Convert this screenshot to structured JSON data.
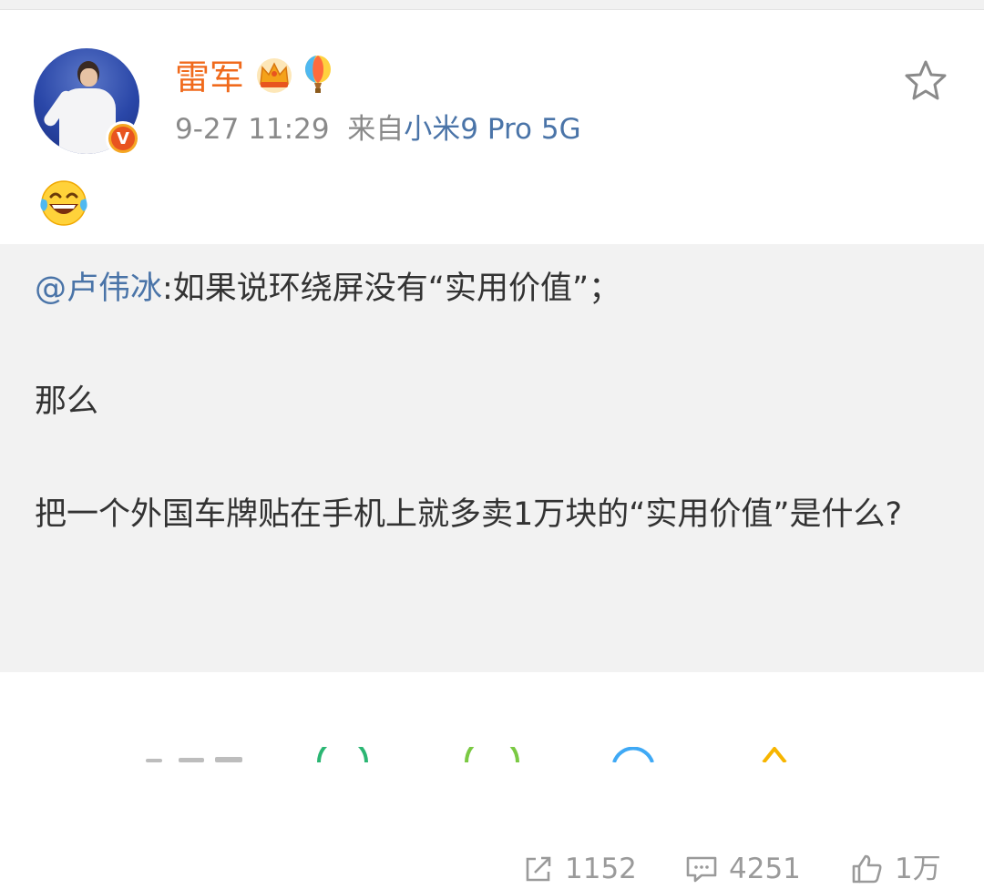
{
  "post": {
    "author": "雷军",
    "time": "9-27 11:29",
    "source_prefix": "来自",
    "device": "小米9 Pro 5G",
    "emoji": "laughing-tears-icon",
    "badge_letter": "V"
  },
  "quote": {
    "mention": "@卢伟冰",
    "line1": ":如果说环绕屏没有“实用价值”；",
    "line2": "那么",
    "line3": "把一个外国车牌贴在手机上就多卖1万块的“实用价值”是什么?"
  },
  "stats": {
    "reposts": "1152",
    "comments": "4251",
    "likes": "1万"
  },
  "colors": {
    "author": "#f06a1c",
    "link": "#4a74a8",
    "meta": "#8a8a8a",
    "quote_bg": "#f2f2f2"
  }
}
